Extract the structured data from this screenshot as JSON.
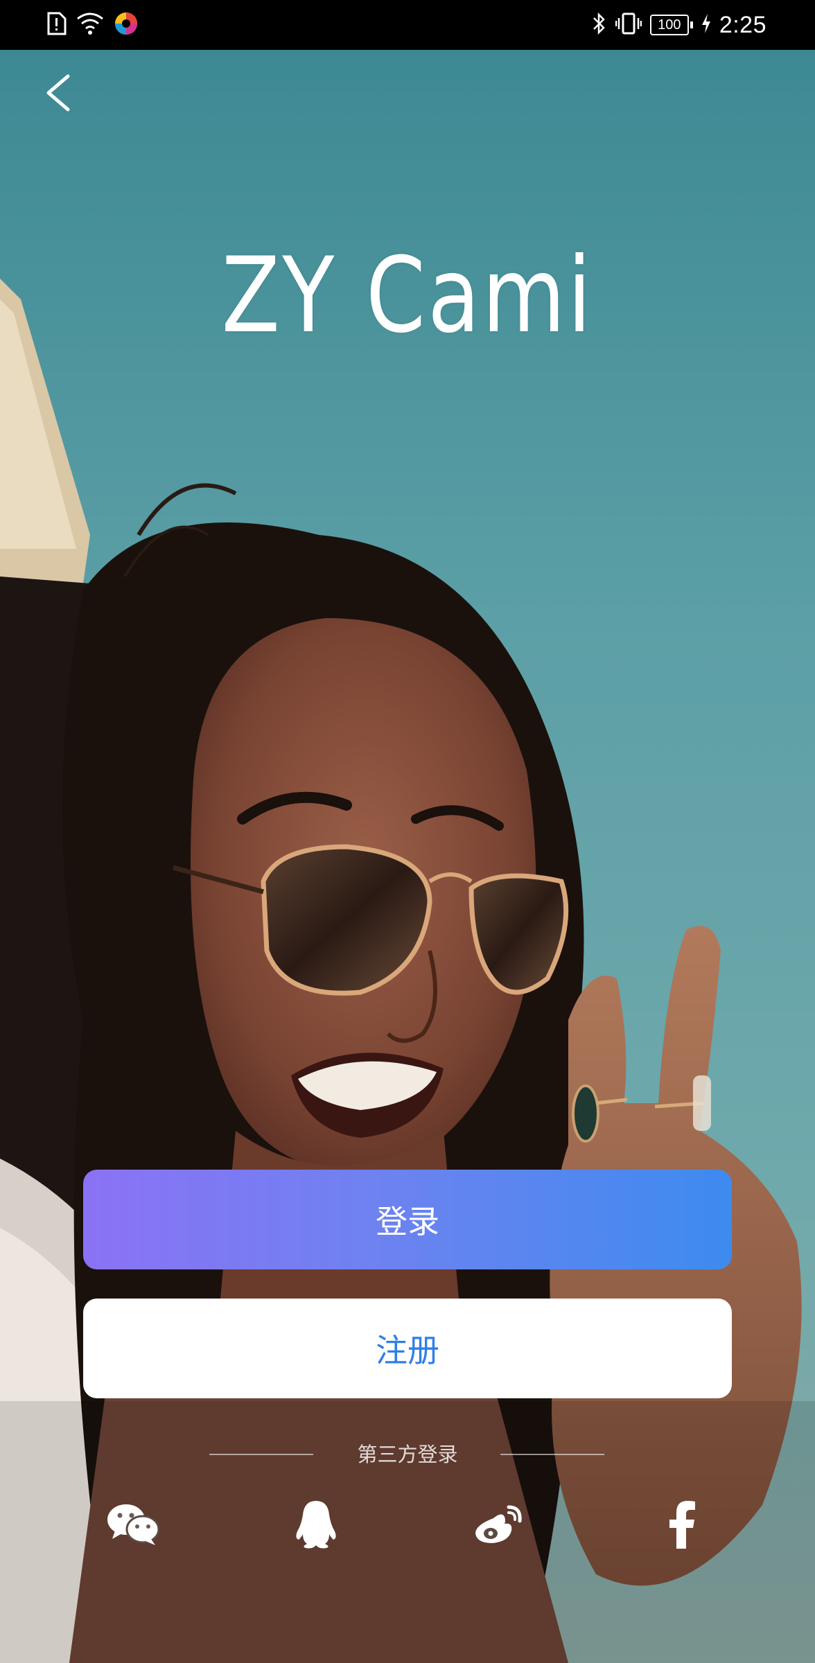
{
  "status_bar": {
    "time": "2:25",
    "battery_level": "100",
    "icons": [
      "sim-alert-icon",
      "wifi-icon",
      "app-notification-icon",
      "bluetooth-icon",
      "vibrate-icon",
      "battery-icon",
      "charging-icon"
    ]
  },
  "app": {
    "title": "ZY Cami"
  },
  "nav": {
    "back_icon": "chevron-left-icon"
  },
  "actions": {
    "login_label": "登录",
    "register_label": "注册"
  },
  "third_party": {
    "label": "第三方登录",
    "providers": [
      {
        "name": "wechat",
        "icon": "wechat-icon"
      },
      {
        "name": "qq",
        "icon": "qq-icon"
      },
      {
        "name": "weibo",
        "icon": "weibo-icon"
      },
      {
        "name": "facebook",
        "icon": "facebook-icon"
      }
    ]
  },
  "colors": {
    "login_gradient_start": "#8b72f5",
    "login_gradient_end": "#3d8bef",
    "register_text": "#2f7fe8",
    "sky": "#5b9ea5"
  }
}
